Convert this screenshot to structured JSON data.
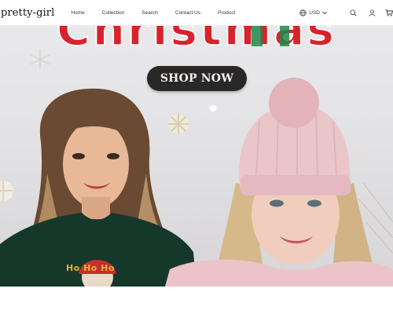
{
  "header": {
    "logo": "pretty-girl",
    "nav": [
      "Home",
      "Collection",
      "Search",
      "Contact Us",
      "Product"
    ],
    "currency": "USD",
    "icons": [
      "globe-icon",
      "chevron-down-icon",
      "search-icon",
      "account-icon",
      "cart-icon"
    ]
  },
  "hero": {
    "title": "Christmas",
    "cta_label": "SHOP NOW",
    "sweater_text": "Ho Ho Ho"
  },
  "colors": {
    "title_red": "#d8232c",
    "title_green": "#1e8a4a",
    "button_bg": "#2a2827",
    "sweater_green": "#16382a",
    "beanie_pink": "#eac6cb"
  }
}
